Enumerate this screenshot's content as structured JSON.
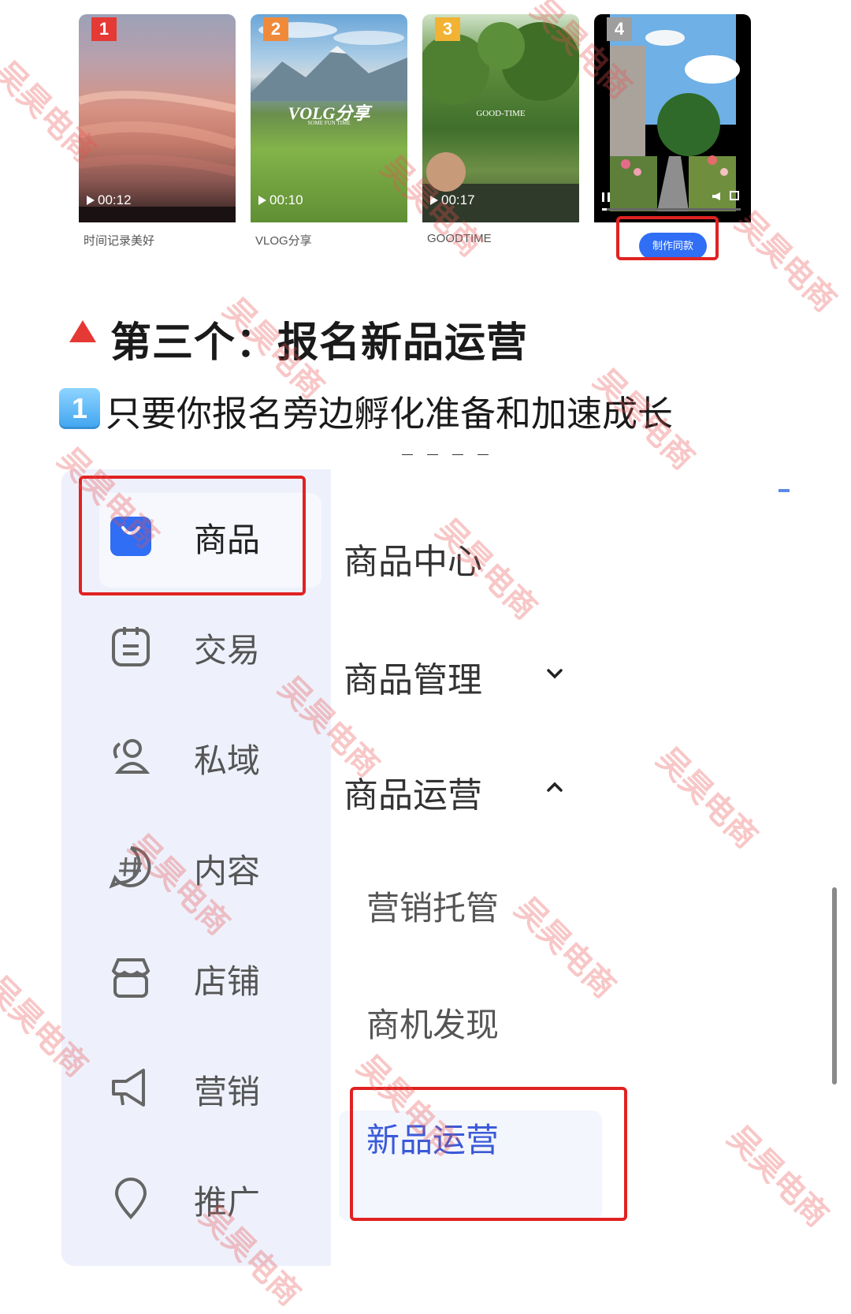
{
  "templates": [
    {
      "rank": "1",
      "duration": "00:12",
      "title": "时间记录美好",
      "rank_color": "#e53935"
    },
    {
      "rank": "2",
      "duration": "00:10",
      "title": "VLOG分享",
      "overlay": "VOLG分享",
      "overlay_sub": "SOME FUN TIME",
      "rank_color": "#f08a3b"
    },
    {
      "rank": "3",
      "duration": "00:17",
      "title": "GOODTIME",
      "overlay": "GOOD-TIME",
      "rank_color": "#f2b233"
    },
    {
      "rank": "4",
      "button": "制作同款",
      "rank_color": "#9e9e9e"
    }
  ],
  "section": {
    "heading": "第三个：报名新品运营",
    "keycap": "1",
    "subline": "只要你报名旁边孵化准备和加速成长"
  },
  "sidebar": {
    "items": [
      {
        "label": "商品",
        "icon": "bag-icon"
      },
      {
        "label": "交易",
        "icon": "clipboard-icon"
      },
      {
        "label": "私域",
        "icon": "users-icon"
      },
      {
        "label": "内容",
        "icon": "hashtag-icon"
      },
      {
        "label": "店铺",
        "icon": "store-icon"
      },
      {
        "label": "营销",
        "icon": "megaphone-icon"
      },
      {
        "label": "推广",
        "icon": "location-pin-icon"
      }
    ]
  },
  "submenu": {
    "center": "商品中心",
    "manage": "商品管理",
    "operate": "商品运营",
    "children": [
      "营销托管",
      "商机发现",
      "新品运营"
    ]
  },
  "watermark": "吴昊电商",
  "colors": {
    "accent": "#2f6ef5",
    "highlight": "#e02222",
    "selected": "#3a5ad8"
  }
}
